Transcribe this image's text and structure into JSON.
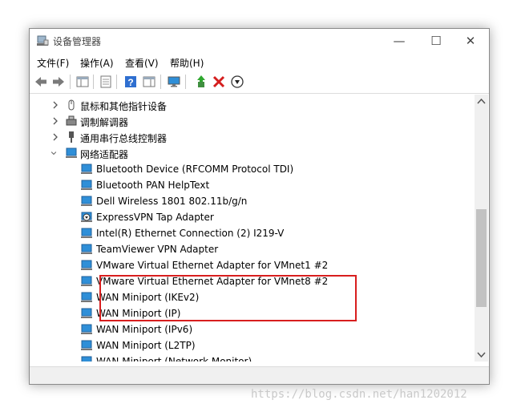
{
  "window": {
    "title": "设备管理器",
    "controls": {
      "minimize": "—",
      "maximize": "☐",
      "close": "✕"
    }
  },
  "menu": [
    "文件(F)",
    "操作(A)",
    "查看(V)",
    "帮助(H)"
  ],
  "toolbar": {
    "icons": [
      "back-arrow-icon",
      "forward-arrow-icon",
      "show-hide-tree-icon",
      "properties-icon",
      "help-icon",
      "view-icon",
      "monitor-icon",
      "update-driver-icon",
      "uninstall-icon",
      "disable-device-icon"
    ]
  },
  "tree": {
    "categories": [
      {
        "label": "鼠标和其他指针设备",
        "expanded": false,
        "icon": "mouse-icon"
      },
      {
        "label": "调制解调器",
        "expanded": false,
        "icon": "modem-icon"
      },
      {
        "label": "通用串行总线控制器",
        "expanded": false,
        "icon": "usb-icon"
      },
      {
        "label": "网络适配器",
        "expanded": true,
        "icon": "network-adapter-icon"
      }
    ],
    "adapters": [
      "Bluetooth Device (RFCOMM Protocol TDI)",
      "Bluetooth PAN HelpText",
      "Dell Wireless 1801 802.11b/g/n",
      "ExpressVPN Tap Adapter",
      "Intel(R) Ethernet Connection (2) I219-V",
      "TeamViewer VPN Adapter",
      "VMware Virtual Ethernet Adapter for VMnet1 #2",
      "VMware Virtual Ethernet Adapter for VMnet8 #2",
      "WAN Miniport (IKEv2)",
      "WAN Miniport (IP)",
      "WAN Miniport (IPv6)",
      "WAN Miniport (L2TP)",
      "WAN Miniport (Network Monitor)"
    ]
  },
  "watermark": "https://blog.csdn.net/han1202012",
  "colors": {
    "highlight": "#d81e1e",
    "network_icon": "#2f8fd8"
  }
}
